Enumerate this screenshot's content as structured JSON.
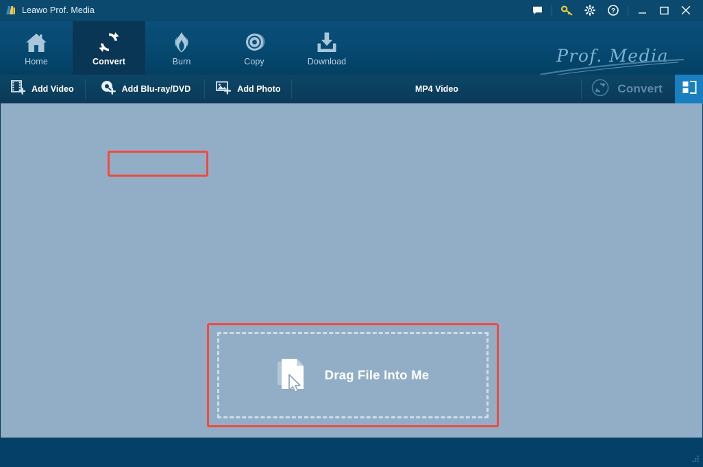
{
  "window": {
    "title": "Leawo Prof. Media",
    "app_icon": "leawo-logo-icon",
    "controls": {
      "feedback": "feedback-icon",
      "register": "key-icon",
      "settings": "gear-icon",
      "help": "help-icon",
      "minimize": "minimize-icon",
      "maximize": "maximize-icon",
      "close": "close-icon"
    }
  },
  "navbar": {
    "items": [
      {
        "label": "Home",
        "icon": "home-icon",
        "active": false
      },
      {
        "label": "Convert",
        "icon": "convert-icon",
        "active": true
      },
      {
        "label": "Burn",
        "icon": "flame-icon",
        "active": false
      },
      {
        "label": "Copy",
        "icon": "disc-icon",
        "active": false
      },
      {
        "label": "Download",
        "icon": "download-icon",
        "active": false
      }
    ],
    "brand": "Prof. Media"
  },
  "subbar": {
    "add_video": {
      "label": "Add Video",
      "icon": "film-plus-icon"
    },
    "add_bluray": {
      "label": "Add Blu-ray/DVD",
      "icon": "disc-plus-icon",
      "highlighted": true
    },
    "add_photo": {
      "label": "Add Photo",
      "icon": "photo-plus-icon"
    },
    "format": "MP4 Video",
    "convert_label": "Convert",
    "convert_icon": "convert-circle-icon",
    "panel_toggle_icon": "panel-layout-icon"
  },
  "content": {
    "dropzone": {
      "text": "Drag File Into Me",
      "icon": "file-drag-icon",
      "highlighted": true
    }
  },
  "statusbar": {
    "resize_grip": "resize-grip-icon"
  },
  "colors": {
    "titlebar": "#0b4a6e",
    "navbar_top": "#0a4f7a",
    "navbar_bottom": "#034063",
    "nav_active": "#0a3655",
    "subbar": "#0b3c5c",
    "content": "#92aec7",
    "statusbar": "#044068",
    "accent_blue": "#1a7fc1",
    "highlight_red": "#f4483c",
    "brand_text": "#7fb2d4",
    "convert_disabled": "#5f8aa8"
  }
}
